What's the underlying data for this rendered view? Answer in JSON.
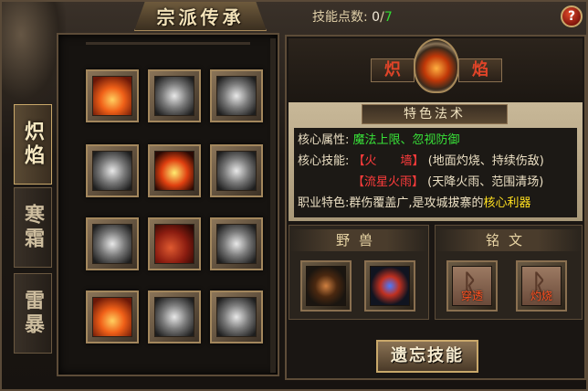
{
  "header": {
    "title": "宗派传承",
    "skill_points_label": "技能点数:",
    "skill_points_used": "0",
    "skill_points_sep": "/",
    "skill_points_max": "7",
    "help_label": "?"
  },
  "tabs": [
    {
      "label": "炽焰",
      "active": true
    },
    {
      "label": "寒霜",
      "active": false
    },
    {
      "label": "雷暴",
      "active": false
    }
  ],
  "skill_grid": {
    "slots": [
      {
        "icon": "flame-skill-icon",
        "style": "fire",
        "learned": true
      },
      {
        "icon": "cross-slash-skill-icon",
        "style": "gray",
        "learned": false
      },
      {
        "icon": "swirl-skill-icon",
        "style": "gray",
        "learned": false
      },
      {
        "icon": "fire-pillar-skill-icon",
        "style": "gray",
        "learned": false
      },
      {
        "icon": "fireball-skill-icon",
        "style": "ember",
        "learned": true
      },
      {
        "icon": "smoke-skill-icon",
        "style": "gray",
        "learned": false
      },
      {
        "icon": "rune-circle-skill-icon",
        "style": "gray",
        "learned": false
      },
      {
        "icon": "magma-fist-skill-icon",
        "style": "magma",
        "learned": true
      },
      {
        "icon": "whip-skill-icon",
        "style": "gray",
        "learned": false
      },
      {
        "icon": "meteor-skill-icon",
        "style": "fire",
        "learned": true
      },
      {
        "icon": "firewall-skill-icon",
        "style": "gray",
        "learned": false
      },
      {
        "icon": "shell-shield-skill-icon",
        "style": "gray",
        "learned": false
      }
    ]
  },
  "school": {
    "name_left": "炽",
    "name_right": "焰",
    "emblem_icon": "flame-emblem-icon"
  },
  "feature": {
    "title": "特色法术",
    "core_attr_label": "核心属性:",
    "core_attr_value": "魔法上限、忽视防御",
    "core_skill_label": "核心技能:",
    "skill1_name": "【火　　墙】",
    "skill1_desc": "(地面灼烧、持续伤敌)",
    "skill2_name": "【流星火雨】",
    "skill2_desc": "(天降火雨、范围清场)",
    "job_label": "职业特色:",
    "job_desc": "群伤覆盖广,是攻城拔寨的",
    "job_highlight": "核心利器"
  },
  "beast": {
    "title": "野兽",
    "items": [
      {
        "icon": "fire-beast-icon"
      },
      {
        "icon": "blue-beast-icon"
      }
    ]
  },
  "runes": {
    "title": "铭文",
    "items": [
      {
        "icon": "rune-icon",
        "label": "穿透"
      },
      {
        "icon": "rune-icon",
        "label": "灼烧"
      }
    ]
  },
  "actions": {
    "forget_label": "遗忘技能"
  }
}
